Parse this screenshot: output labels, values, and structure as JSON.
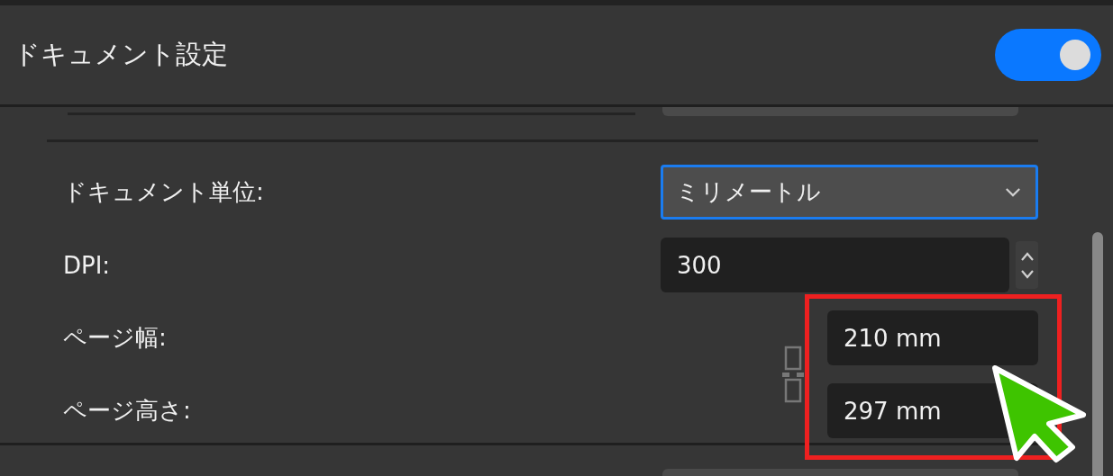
{
  "header": {
    "title": "ドキュメント設定",
    "toggle": {
      "on": true
    }
  },
  "fields": [
    {
      "kind": "select",
      "label": "ドキュメント単位:",
      "value": "ミリメートル",
      "focused": true
    },
    {
      "kind": "spin",
      "label": "DPI:",
      "value": "300"
    },
    {
      "kind": "linked",
      "label": "ページ幅:",
      "value": "210 mm"
    },
    {
      "kind": "linked",
      "label": "ページ高さ:",
      "value": "297 mm"
    }
  ],
  "annotations": [
    {
      "kind": "highlight"
    },
    {
      "kind": "cursor"
    }
  ]
}
